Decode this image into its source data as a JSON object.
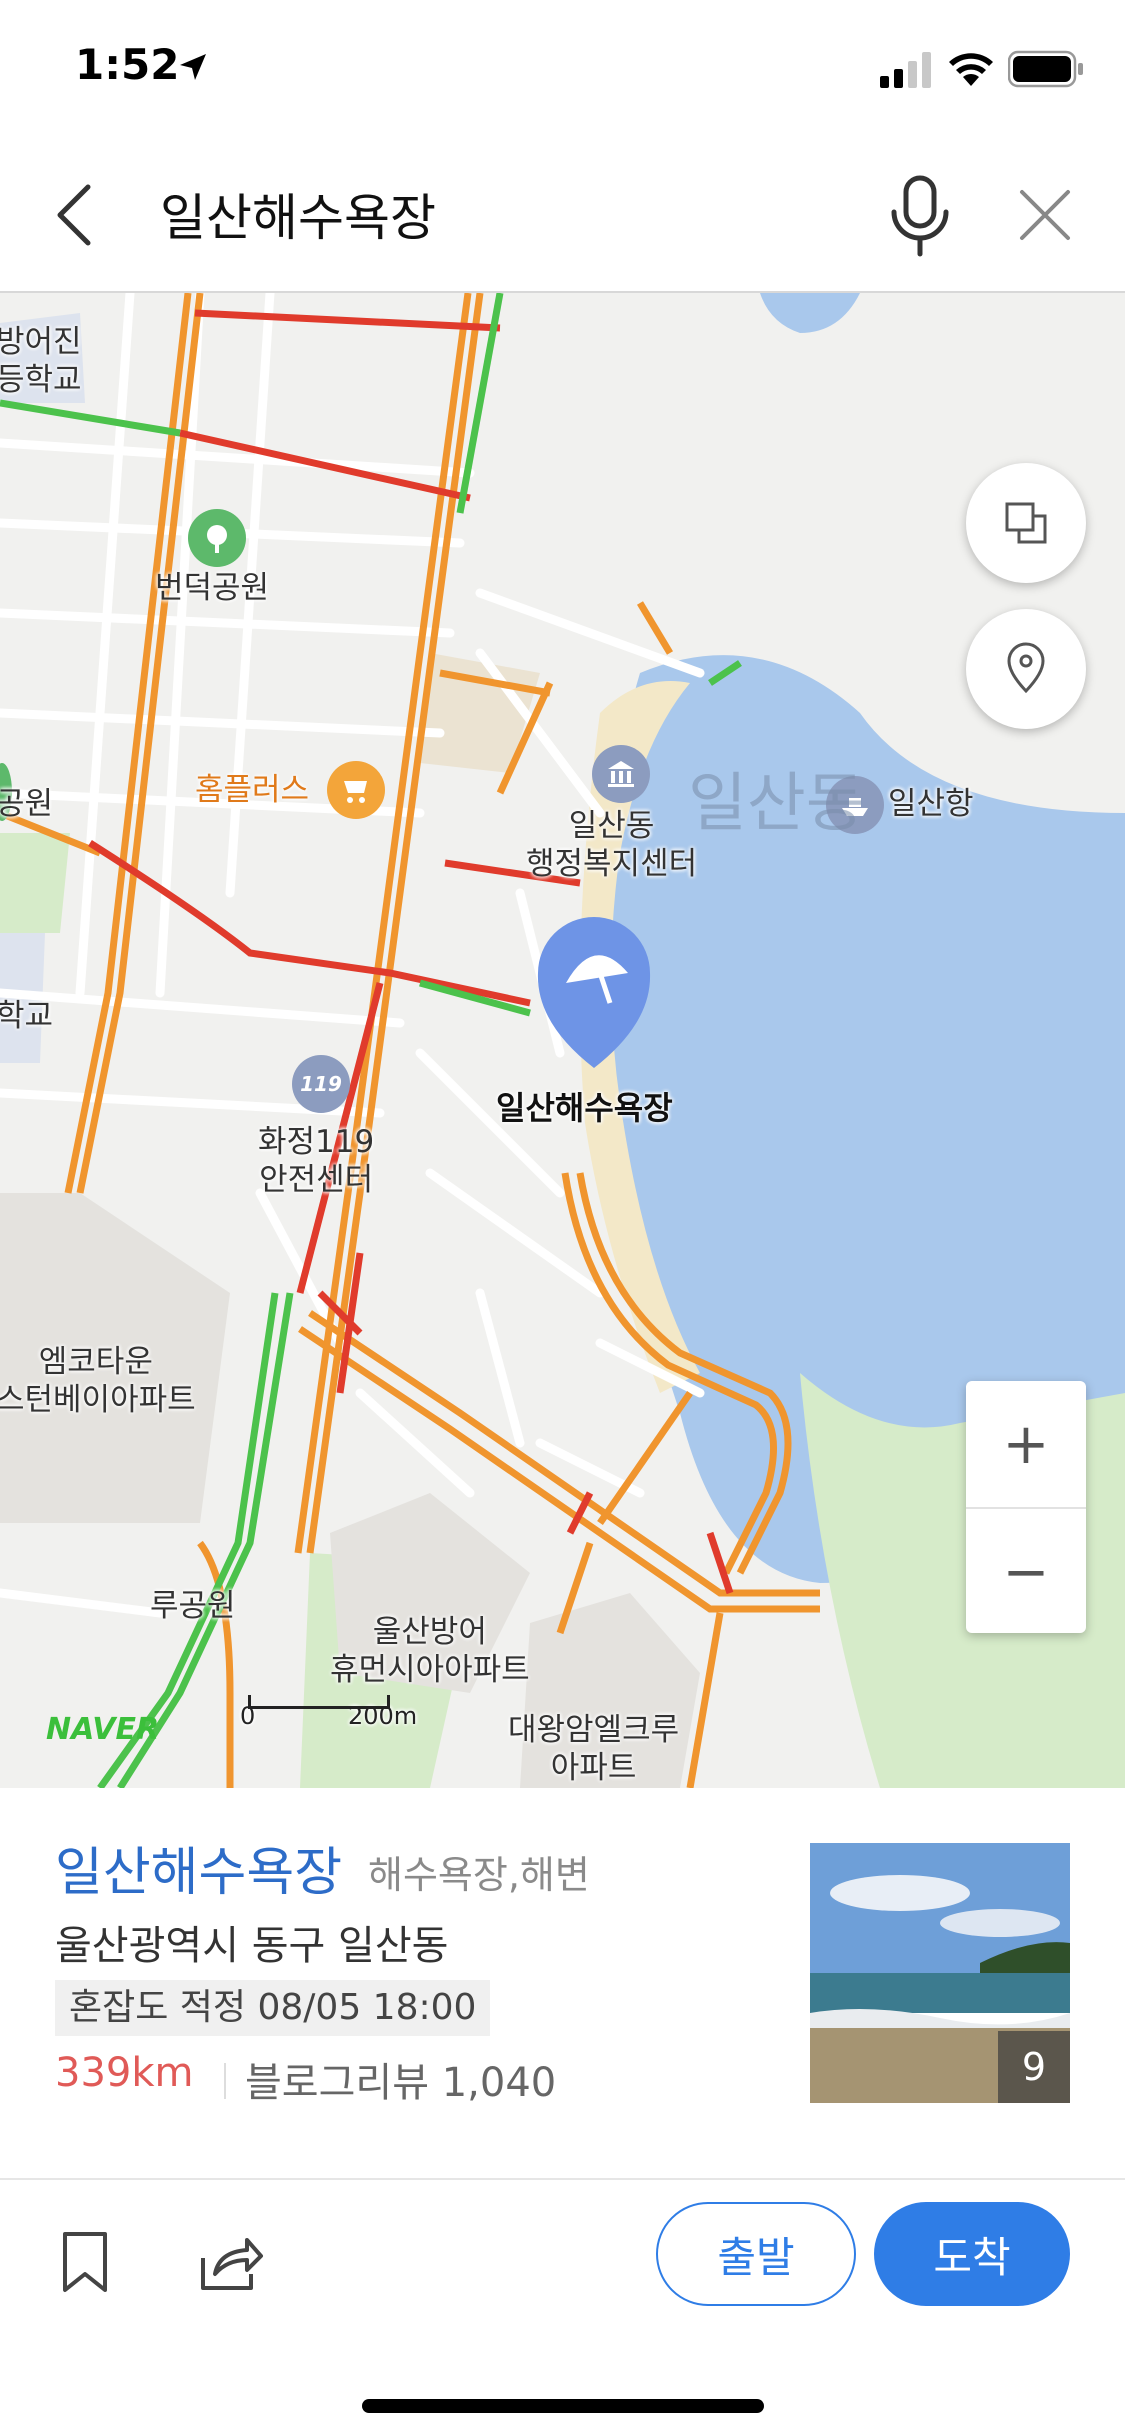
{
  "status_bar": {
    "time": "1:52",
    "icons": [
      "location-arrow-icon",
      "signal-icon",
      "wifi-icon",
      "battery-icon"
    ]
  },
  "search": {
    "query": "일산해수욕장",
    "icons": [
      "back-icon",
      "mic-icon",
      "close-icon"
    ]
  },
  "map": {
    "labels": {
      "school_top_line1": "방어진",
      "school_top_line2": "등학교",
      "park_beondeok": "번덕공원",
      "homeplus": "홈플러스",
      "park_left": "공원",
      "ilsan_office_line1": "일산동",
      "ilsan_office_line2": "행정복지센터",
      "district": "일산동",
      "ilsan_port": "일산항",
      "school_left": "학교",
      "selected_place": "일산해수욕장",
      "fire_station_line1": "화정119",
      "fire_station_line2": "안전센터",
      "apt_emco_line1": "엠코타운",
      "apt_emco_line2": "스턴베이아파트",
      "park_bottom": "루공원",
      "apt_ulsan_line1": "울산방어",
      "apt_ulsan_line2": "휴먼시아아파트",
      "apt_daewang_line1": "대왕암엘크루",
      "apt_daewang_line2": "아파트",
      "naver": "NAVER",
      "scale_zero": "0",
      "scale_distance": "200m"
    },
    "controls": {
      "zoom_in": "+",
      "zoom_out": "−"
    },
    "colors": {
      "water": "#a9c8ec",
      "beach": "#f3e8c8",
      "green": "#d6ebc9",
      "traffic_slow": "#f0952e",
      "traffic_jam": "#e03b2c",
      "traffic_free": "#4cc24c",
      "marker": "#6e94e6"
    }
  },
  "place": {
    "name": "일산해수욕장",
    "category": "해수욕장,해변",
    "address": "울산광역시 동구 일산동",
    "congestion": "혼잡도 적정 08/05 18:00",
    "distance": "339km",
    "blog_review": "블로그리뷰 1,040",
    "photo_count": "9"
  },
  "actions": {
    "depart": "출발",
    "arrive": "도착",
    "icons": [
      "bookmark-icon",
      "share-icon"
    ]
  }
}
